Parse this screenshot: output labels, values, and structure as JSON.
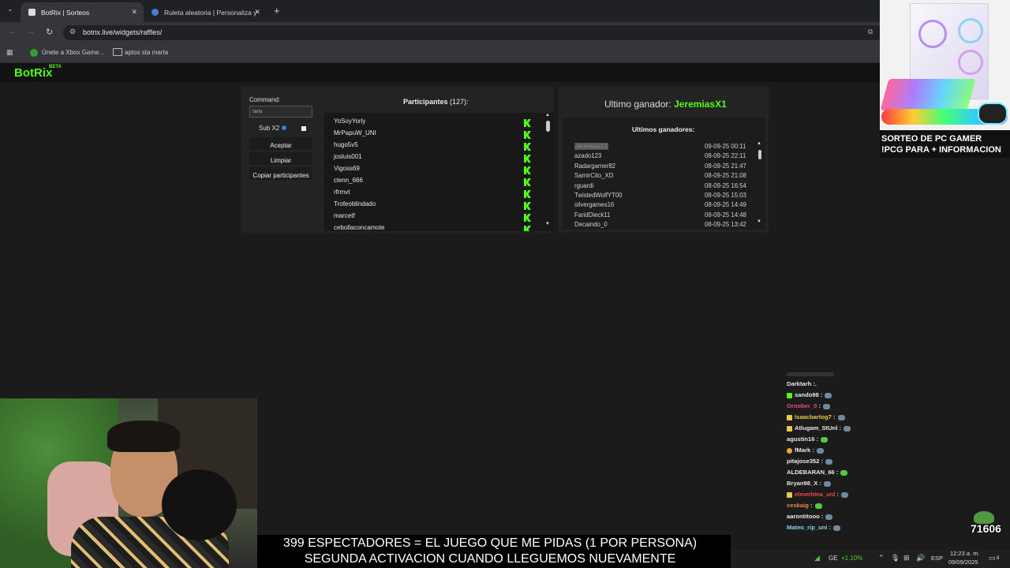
{
  "browser": {
    "tabs": [
      {
        "title": "BotRix | Sorteos"
      },
      {
        "title": "Ruleta aleatoria | Personaliza y"
      }
    ],
    "new_tab": "+",
    "url": "botrix.live/widgets/raffles/",
    "bookmarks": [
      "Únete a Xbox Game...",
      "aptos sta marta"
    ]
  },
  "site": {
    "logo": "BotRix",
    "logo_badge": "BETA"
  },
  "controls": {
    "command_label": "Command:",
    "command_value": "!aris",
    "sub_label": "Sub X2",
    "accept": "Aceptar",
    "clear": "Limpiar",
    "copy": "Copiar participantes"
  },
  "participants": {
    "title": "Participantes",
    "count": "(127):",
    "names": [
      "YoSoyYorly",
      "MrPapuW_UNI",
      "hugo5v5",
      "josluis001",
      "Vigoss69",
      "clenn_666",
      "rfrmvt",
      "Trofeoblindado",
      "marcetf",
      "cebollaconcamote"
    ]
  },
  "winner": {
    "label": "Ultimo ganador:",
    "name": "JeremiasX1",
    "recent_title": "Ultimos ganadores:",
    "recent": [
      {
        "name": "JeremiasX1",
        "date": "09-09-25 00:11"
      },
      {
        "name": "azado123",
        "date": "08-09-25 22:11"
      },
      {
        "name": "Radargamer82",
        "date": "08-09-25 21:47"
      },
      {
        "name": "SamirCito_XD",
        "date": "08-09-25 21:08"
      },
      {
        "name": "rguardi",
        "date": "08-09-25 16:54"
      },
      {
        "name": "TwistedWolfYT00",
        "date": "08-09-25 15:03"
      },
      {
        "name": "silvergames16",
        "date": "08-09-25 14:49"
      },
      {
        "name": "FaridDieck11",
        "date": "08-09-25 14:48"
      },
      {
        "name": "Decaindo_0",
        "date": "08-09-25 13:42"
      }
    ]
  },
  "ad": {
    "line1": "SORTEO DE PC GAMER",
    "line2": "!PCG PARA + INFORMACION"
  },
  "chat": [
    {
      "user": "Darktarh",
      "color": "#e8e8e8"
    },
    {
      "user": "sando98",
      "color": "#e8e8e8"
    },
    {
      "user": "Groober_0",
      "color": "#e84a7a"
    },
    {
      "user": "Isaacbartog7",
      "color": "#e8c84a"
    },
    {
      "user": "Atlugam_StUnl",
      "color": "#e8e8e8"
    },
    {
      "user": "agustin16",
      "color": "#e8e8e8"
    },
    {
      "user": "fMark",
      "color": "#e8e8e8"
    },
    {
      "user": "pitajose352",
      "color": "#e8e8e8"
    },
    {
      "user": "ALDEBARAN_66",
      "color": "#e8e8e8"
    },
    {
      "user": "Bryan98_X",
      "color": "#e8e8e8"
    },
    {
      "user": "elmerhtea_unl",
      "color": "#e84a4a"
    },
    {
      "user": "ceskaig",
      "color": "#e88a4a"
    },
    {
      "user": "aarontitooo",
      "color": "#e8e8e8"
    },
    {
      "user": "Mateo_rip_uni",
      "color": "#8ad0f0"
    }
  ],
  "chat_separator": ":",
  "follow_counter": "71606",
  "banner": {
    "line1": "399 ESPECTADORES = EL JUEGO QUE ME PIDAS (1 POR PERSONA)",
    "line2": "SEGUNDA ACTIVACION CUANDO LLEGUEMOS NUEVAMENTE"
  },
  "taskbar": {
    "ticker": "GE",
    "change": "+1.10%",
    "lang": "ESP",
    "time": "12:23 a. m.",
    "date": "09/09/2025",
    "notifications": "8"
  },
  "colors": {
    "accent_green": "#53fc18",
    "bg": "#1b1b1b"
  }
}
